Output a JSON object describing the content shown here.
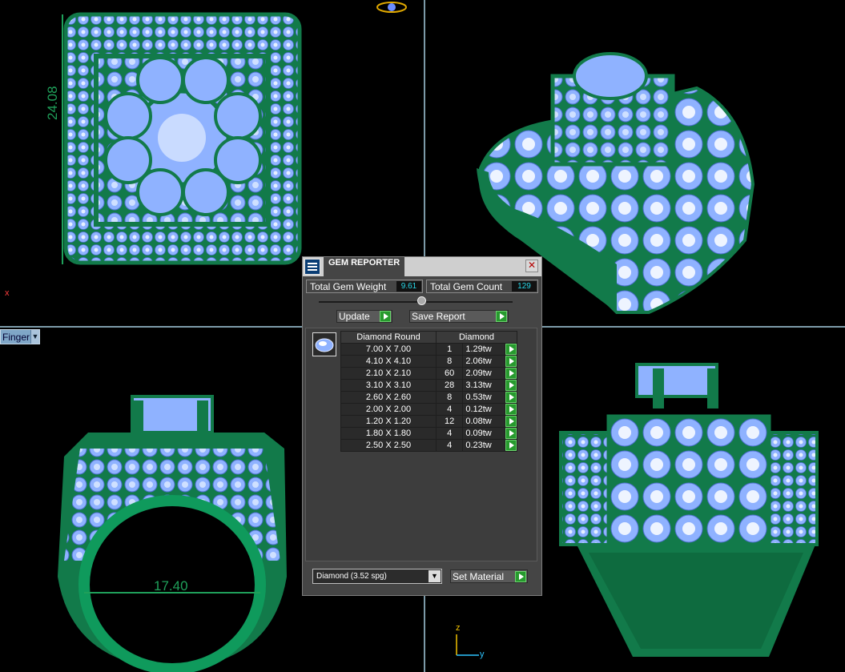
{
  "viewport": {
    "dimension_height": "24.08",
    "dimension_width": "17.40",
    "axis_x_marker": "x",
    "finger_tag": "Finger",
    "gizmo_z": "z",
    "gizmo_y": "y"
  },
  "colors": {
    "metal": "#127a4a",
    "gem": "#8fb2ff",
    "accent_green": "#279a2e"
  },
  "gem_reporter": {
    "title": "GEM REPORTER",
    "total_weight_label": "Total Gem Weight",
    "total_weight_value": "9.61",
    "total_count_label": "Total Gem Count",
    "total_count_value": "129",
    "update_label": "Update",
    "save_report_label": "Save Report",
    "table_header_shape": "Diamond Round",
    "table_header_material": "Diamond",
    "rows": [
      {
        "size": "7.00 X 7.00",
        "count": "1",
        "weight": "1.29tw"
      },
      {
        "size": "4.10 X 4.10",
        "count": "8",
        "weight": "2.06tw"
      },
      {
        "size": "2.10 X 2.10",
        "count": "60",
        "weight": "2.09tw"
      },
      {
        "size": "3.10 X 3.10",
        "count": "28",
        "weight": "3.13tw"
      },
      {
        "size": "2.60 X 2.60",
        "count": "8",
        "weight": "0.53tw"
      },
      {
        "size": "2.00 X 2.00",
        "count": "4",
        "weight": "0.12tw"
      },
      {
        "size": "1.20 X 1.20",
        "count": "12",
        "weight": "0.08tw"
      },
      {
        "size": "1.80 X 1.80",
        "count": "4",
        "weight": "0.09tw"
      },
      {
        "size": "2.50 X 2.50",
        "count": "4",
        "weight": "0.23tw"
      }
    ],
    "material_selected": "Diamond     (3.52 spg)",
    "set_material_label": "Set Material"
  }
}
